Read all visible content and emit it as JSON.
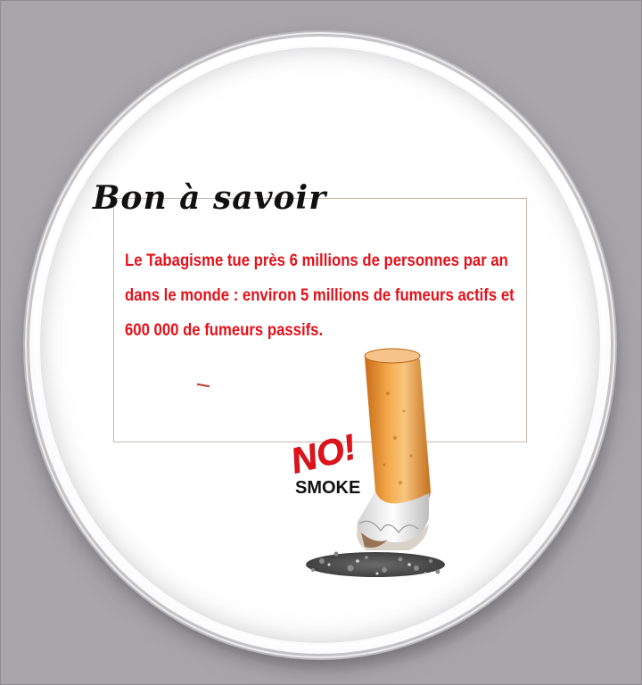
{
  "title": "Bon à savoir",
  "body_lines": [
    "Le Tabagisme tue près 6 millions de personnes par an",
    "dans le monde : environ 5 millions de fumeurs actifs et",
    "600 000 de fumeurs passifs."
  ],
  "logo": {
    "no_text": "NO!",
    "smoke_text": "SMOKE",
    "no_color": "#e2121b",
    "smoke_color": "#111111"
  },
  "colors": {
    "background": "#a8a6ab",
    "body_text": "#e2121b",
    "title_text": "#111111",
    "filter_orange": "#e89a3a"
  },
  "icons": [
    "cigarette-butt-icon",
    "ash-icon"
  ]
}
